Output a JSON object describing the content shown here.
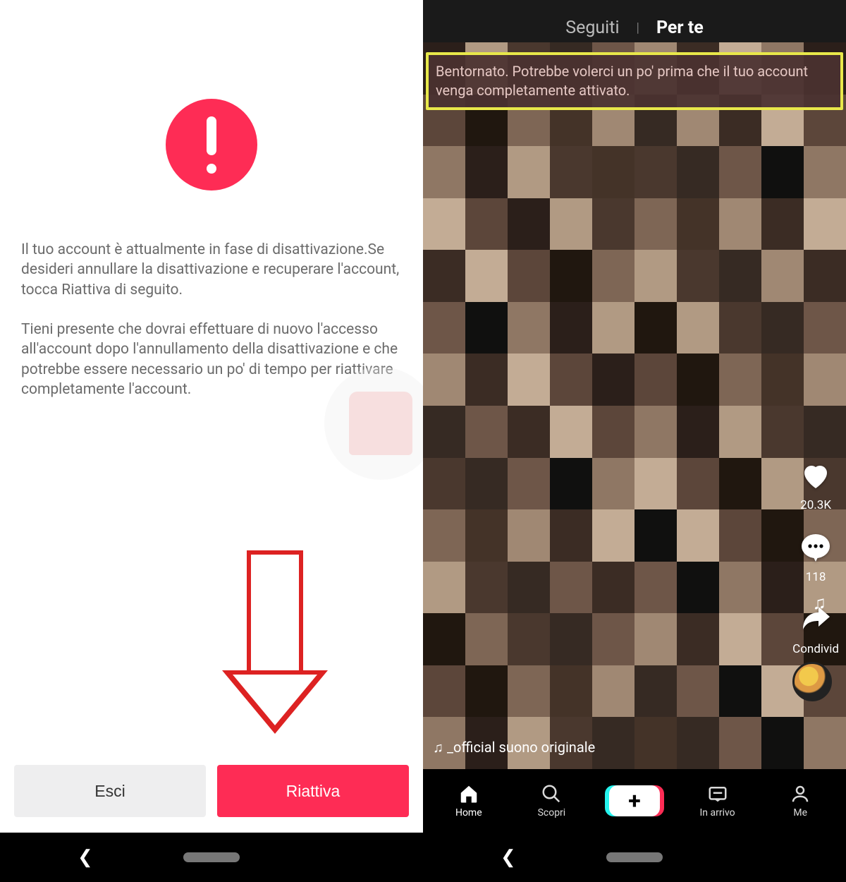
{
  "left": {
    "paragraph1": "Il tuo account è attualmente in fase di disattivazione.Se desideri annullare la disattivazione e recuperare l'account, tocca Riattiva di seguito.",
    "paragraph2": "Tieni presente che dovrai effettuare di nuovo l'accesso all'account dopo l'annullamento della disattivazione e che potrebbe essere necessario un po' di tempo per riattivare completamente l'account.",
    "esci_label": "Esci",
    "riattiva_label": "Riattiva"
  },
  "right": {
    "tab_following": "Seguiti",
    "tab_foryou": "Per te",
    "banner_text": "Bentornato. Potrebbe volerci un po' prima che il tuo account venga completamente attivato.",
    "like_count": "20.3K",
    "comment_count": "118",
    "share_label": "Condivid",
    "sound_line": "♫  _official   suono originale",
    "nav": {
      "home": "Home",
      "discover": "Scopri",
      "inbox": "In arrivo",
      "me": "Me"
    }
  }
}
